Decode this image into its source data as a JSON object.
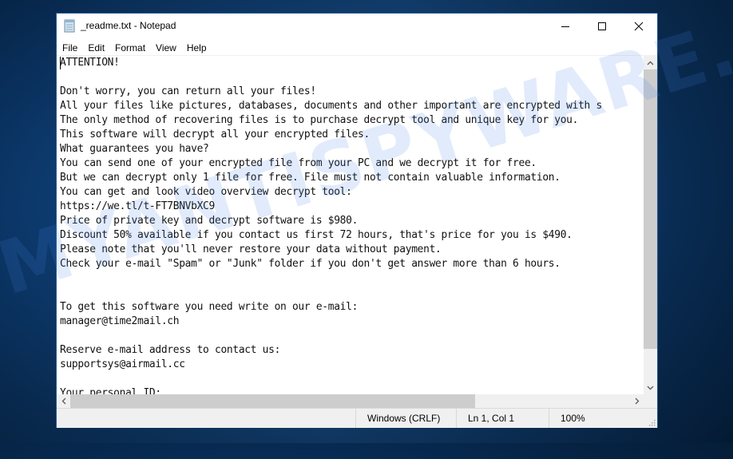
{
  "window": {
    "title": "_readme.txt - Notepad",
    "controls": {
      "minimize": "minimize-icon",
      "maximize": "maximize-icon",
      "close": "close-icon"
    }
  },
  "menu": {
    "items": [
      {
        "label": "File"
      },
      {
        "label": "Edit"
      },
      {
        "label": "Format"
      },
      {
        "label": "View"
      },
      {
        "label": "Help"
      }
    ]
  },
  "editor": {
    "lines": [
      "ATTENTION!",
      "",
      "Don't worry, you can return all your files!",
      "All your files like pictures, databases, documents and other important are encrypted with s",
      "The only method of recovering files is to purchase decrypt tool and unique key for you.",
      "This software will decrypt all your encrypted files.",
      "What guarantees you have?",
      "You can send one of your encrypted file from your PC and we decrypt it for free.",
      "But we can decrypt only 1 file for free. File must not contain valuable information.",
      "You can get and look video overview decrypt tool:",
      "https://we.tl/t-FT7BNVbXC9",
      "Price of private key and decrypt software is $980.",
      "Discount 50% available if you contact us first 72 hours, that's price for you is $490.",
      "Please note that you'll never restore your data without payment.",
      "Check your e-mail \"Spam\" or \"Junk\" folder if you don't get answer more than 6 hours.",
      "",
      "",
      "To get this software you need write on our e-mail:",
      "manager@time2mail.ch",
      "",
      "Reserve e-mail address to contact us:",
      "supportsys@airmail.cc",
      "",
      "Your personal ID:"
    ]
  },
  "statusbar": {
    "line_ending": "Windows (CRLF)",
    "position": "Ln 1, Col 1",
    "zoom": "100%"
  },
  "watermark": "MYANTISPYWARE.COM",
  "colors": {
    "desktop": "#0a3566",
    "window_bg": "#ffffff",
    "chrome_bg": "#f0f0f0",
    "scroll_thumb": "#cdcdcd",
    "watermark": "#4682e6"
  }
}
